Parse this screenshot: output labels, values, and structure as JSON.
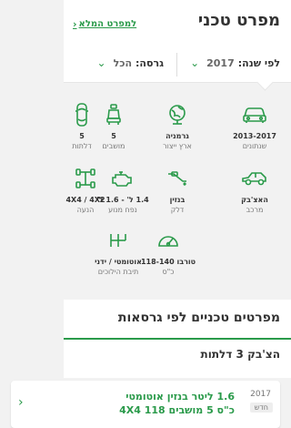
{
  "header": {
    "title": "מפרט טכני",
    "full_spec_link": "למפרט המלא",
    "link_icon": "chevron-left-icon"
  },
  "filters": {
    "year_label": "לפי שנה:",
    "year_value": "2017",
    "trim_label": "גרסה:",
    "trim_value": "הכל"
  },
  "specs": [
    {
      "icon": "car-icon",
      "value": "2013-2017",
      "label": "שנתונים"
    },
    {
      "icon": "globe-icon",
      "value": "גרמניה",
      "label": "ארץ ייצור"
    },
    {
      "icon": "seat-icon",
      "value": "5",
      "label": "מושבים"
    },
    {
      "icon": "car-top-icon",
      "value": "5",
      "label": "דלתות"
    },
    {
      "icon": "car-side-icon",
      "value": "האצ'בק",
      "label": "מרכב"
    },
    {
      "icon": "fuel-pump-icon",
      "value": "בנזין",
      "label": "דלק"
    },
    {
      "icon": "engine-icon",
      "value": "1.4 ל' - 1.6 ל'",
      "label": "נפח מנוע"
    },
    {
      "icon": "drivetrain-icon",
      "value": "4X4 / 4X2",
      "label": "הנעה"
    },
    {
      "icon": "gauge-icon",
      "value": "טורבו 118-140",
      "label": "כ\"ס"
    },
    {
      "icon": "gearbox-icon",
      "value": "אוטומטי / ידני",
      "label": "תיבת הילוכים"
    }
  ],
  "section": {
    "title": "מפרטים טכניים לפי גרסאות",
    "subtitle": "הצ'בק 3 דלתות"
  },
  "card": {
    "year": "2017",
    "badge": "חדש",
    "line1": "1.6 ליטר בנזין אוטומטי",
    "line2": "כ\"ס 5 מושבים 118 4X4"
  }
}
